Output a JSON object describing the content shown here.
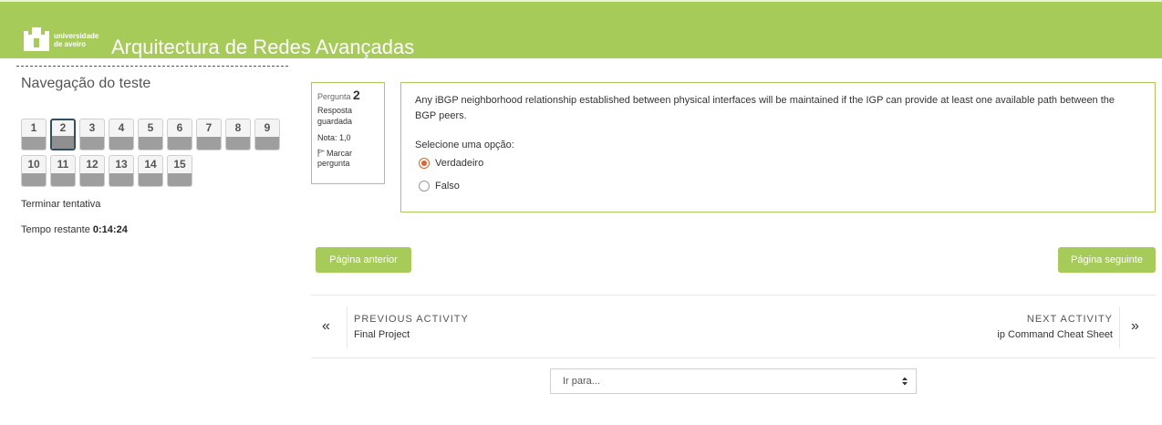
{
  "header": {
    "logo_line1": "universidade",
    "logo_line2": "de aveiro",
    "course_title": "Arquitectura de Redes Avançadas"
  },
  "quiz_nav": {
    "title": "Navegação do teste",
    "questions": [
      "1",
      "2",
      "3",
      "4",
      "5",
      "6",
      "7",
      "8",
      "9",
      "10",
      "11",
      "12",
      "13",
      "14",
      "15"
    ],
    "current": "2",
    "finish_label": "Terminar tentativa",
    "timer_label": "Tempo restante",
    "timer_value": "0:14:24"
  },
  "question": {
    "label": "Pergunta",
    "number": "2",
    "state": "Resposta guardada",
    "grade": "Nota: 1,0",
    "flag_label": "Marcar pergunta",
    "text": "Any iBGP neighborhood relationship established between physical interfaces will be maintained if the IGP can provide at least one available path between the BGP peers.",
    "prompt": "Selecione uma opção:",
    "options": [
      {
        "label": "Verdadeiro",
        "checked": true
      },
      {
        "label": "Falso",
        "checked": false
      }
    ]
  },
  "buttons": {
    "previous_page": "Página anterior",
    "next_page": "Página seguinte"
  },
  "activity_nav": {
    "previous_heading": "PREVIOUS ACTIVITY",
    "previous_name": "Final Project",
    "next_heading": "NEXT ACTIVITY",
    "next_name": "ip Command Cheat Sheet"
  },
  "jump": {
    "placeholder": "Ir para..."
  },
  "colors": {
    "brand_green": "#a6cb59",
    "radio_checked": "#e0622a",
    "current_question_border": "#2f4f66"
  }
}
